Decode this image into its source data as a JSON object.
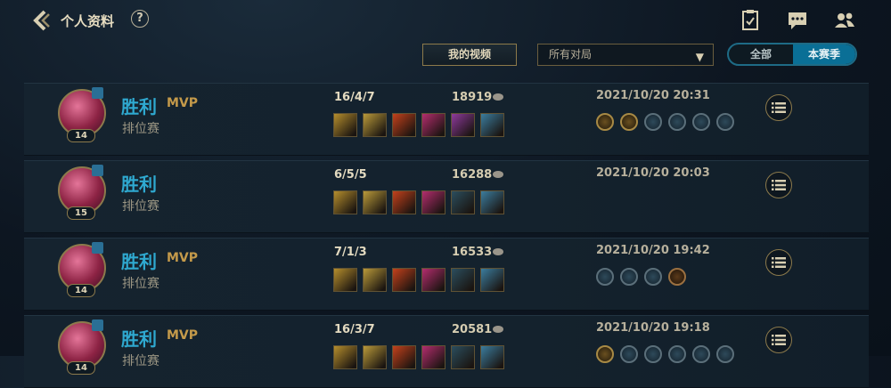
{
  "header": {
    "title": "个人资料",
    "help_label": "?"
  },
  "filters": {
    "video_button": "我的视频",
    "game_filter": "所有对局",
    "segment_all": "全部",
    "segment_season": "本赛季"
  },
  "matches": [
    {
      "result": "胜利",
      "mvp": "MVP",
      "mode": "排位赛",
      "level": "14",
      "kda": "16/4/7",
      "gold": "18919",
      "date": "2021/10/20 20:31",
      "items": [
        "#b58e2d",
        "#b99a3a",
        "#c3411c",
        "#b32d6e",
        "#8e3a9c",
        "#3b7d9e"
      ],
      "badges": [
        "gold",
        "gold",
        "steel",
        "steel",
        "steel",
        "steel"
      ]
    },
    {
      "result": "胜利",
      "mvp": "",
      "mode": "排位赛",
      "level": "15",
      "kda": "6/5/5",
      "gold": "16288",
      "date": "2021/10/20 20:03",
      "items": [
        "#b58e2d",
        "#b99a3a",
        "#c3411c",
        "#b32d6e",
        "#2b4e5e",
        "#3b7d9e"
      ],
      "badges": []
    },
    {
      "result": "胜利",
      "mvp": "MVP",
      "mode": "排位赛",
      "level": "14",
      "kda": "7/1/3",
      "gold": "16533",
      "date": "2021/10/20 19:42",
      "items": [
        "#b58e2d",
        "#b99a3a",
        "#c3411c",
        "#b32d6e",
        "#2b4e5e",
        "#3b7d9e"
      ],
      "badges": [
        "steel",
        "steel",
        "steel",
        "copper"
      ]
    },
    {
      "result": "胜利",
      "mvp": "MVP",
      "mode": "排位赛",
      "level": "14",
      "kda": "16/3/7",
      "gold": "20581",
      "date": "2021/10/20 19:18",
      "items": [
        "#b58e2d",
        "#b99a3a",
        "#c3411c",
        "#b32d6e",
        "#2b4e5e",
        "#3b7d9e"
      ],
      "badges": [
        "gold",
        "steel",
        "steel",
        "steel",
        "steel",
        "steel"
      ]
    }
  ]
}
